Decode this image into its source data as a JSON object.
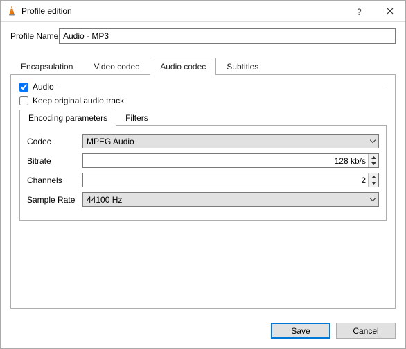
{
  "window": {
    "title": "Profile edition"
  },
  "profile": {
    "label": "Profile Name",
    "value": "Audio - MP3"
  },
  "tabs": {
    "encapsulation": "Encapsulation",
    "video_codec": "Video codec",
    "audio_codec": "Audio codec",
    "subtitles": "Subtitles"
  },
  "audio": {
    "checkbox_label": "Audio",
    "keep_original_label": "Keep original audio track",
    "subtabs": {
      "encoding": "Encoding parameters",
      "filters": "Filters"
    },
    "fields": {
      "codec_label": "Codec",
      "codec_value": "MPEG Audio",
      "bitrate_label": "Bitrate",
      "bitrate_value": "128 kb/s",
      "channels_label": "Channels",
      "channels_value": "2",
      "samplerate_label": "Sample Rate",
      "samplerate_value": "44100 Hz"
    }
  },
  "buttons": {
    "save": "Save",
    "cancel": "Cancel"
  }
}
